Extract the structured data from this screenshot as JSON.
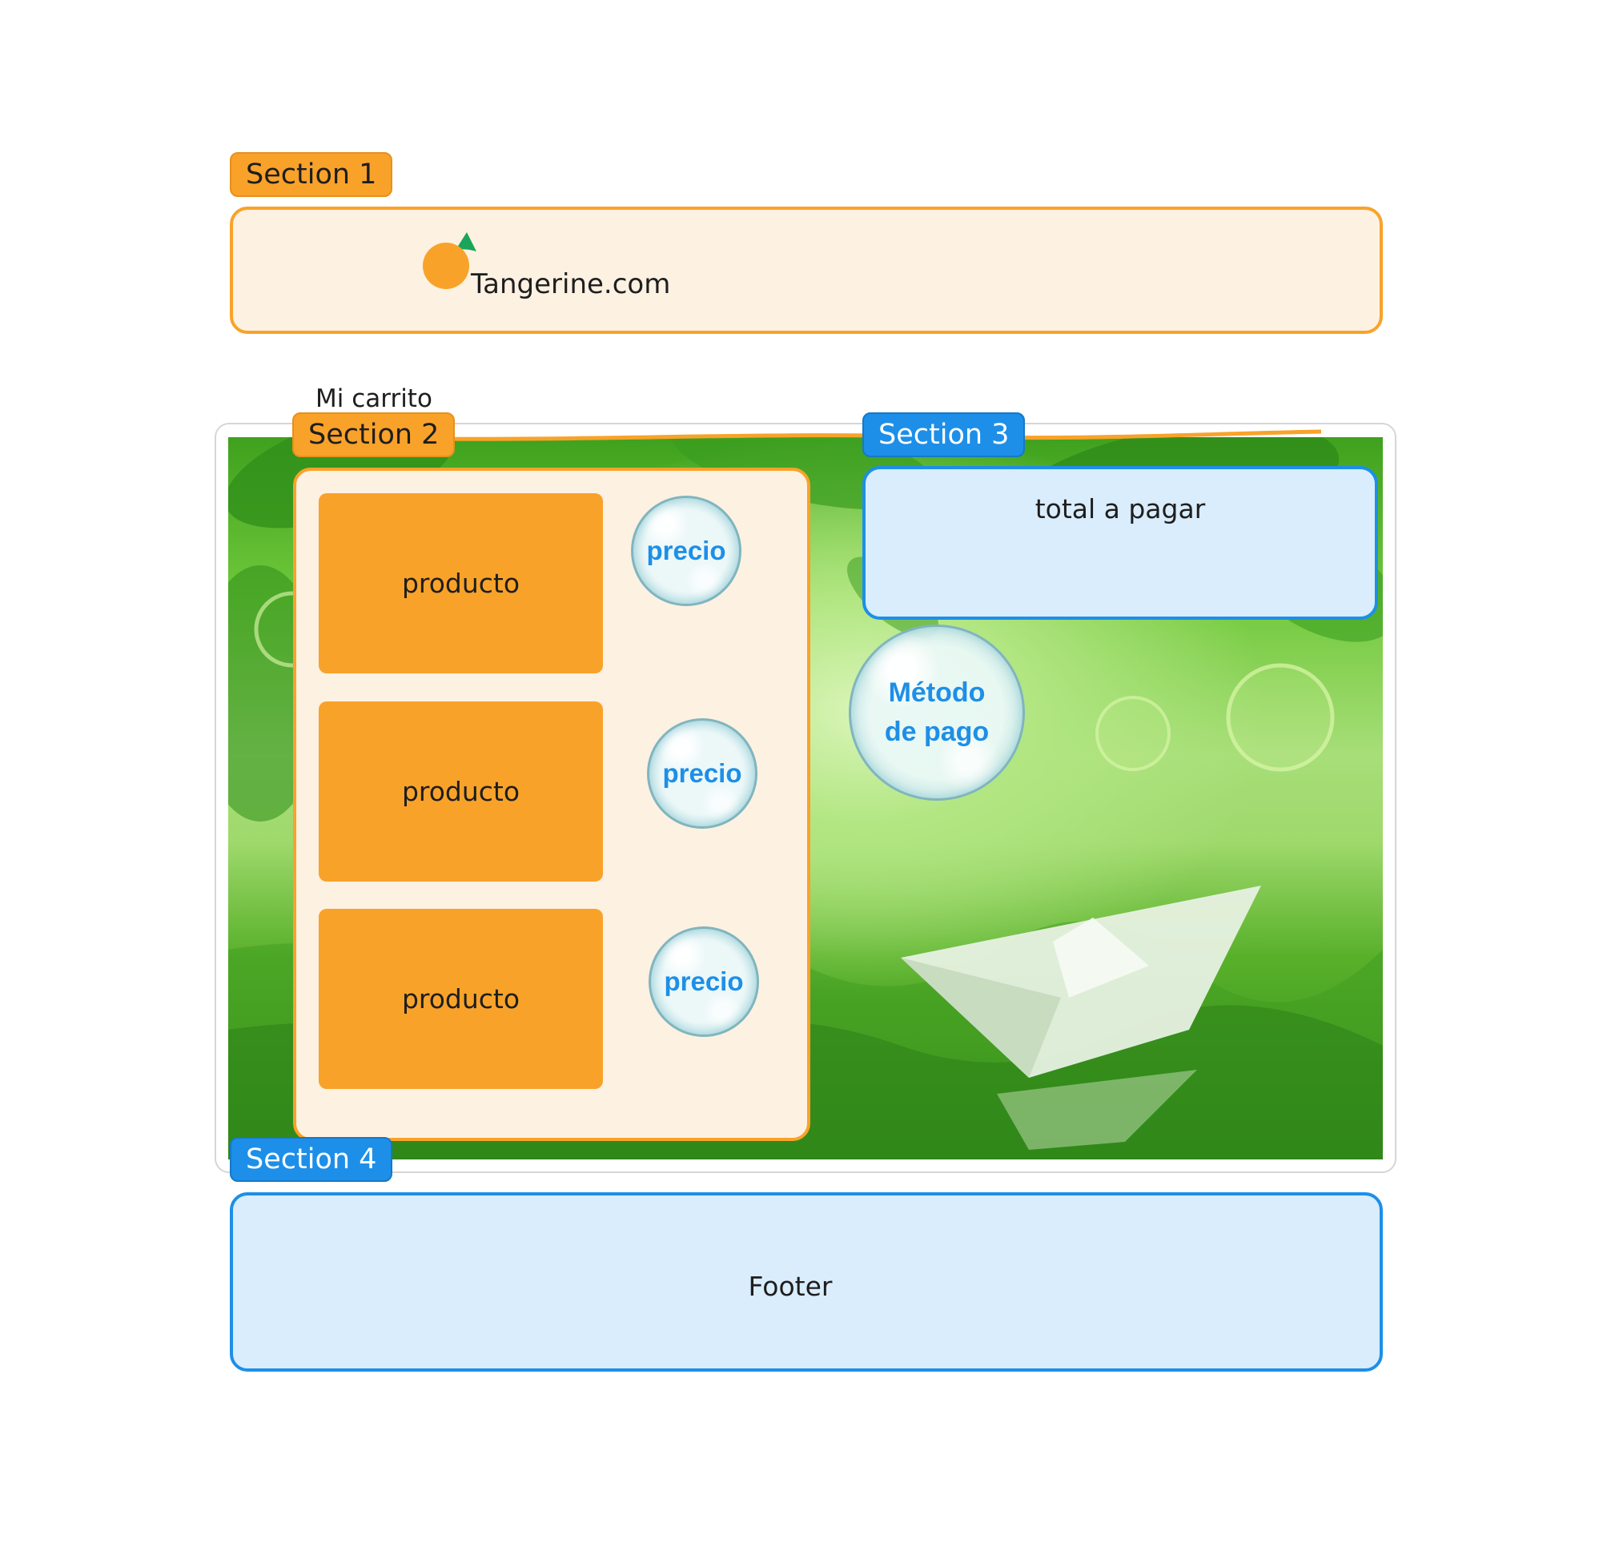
{
  "section1": {
    "tag": "Section 1",
    "logo_text": "Tangerine.com"
  },
  "cart_label": "Mi carrito",
  "section2": {
    "tag": "Section 2",
    "items": [
      {
        "product": "producto",
        "price": "precio"
      },
      {
        "product": "producto",
        "price": "precio"
      },
      {
        "product": "producto",
        "price": "precio"
      }
    ]
  },
  "section3": {
    "tag": "Section 3",
    "total_label": "total a pagar",
    "payment_line1": "Método",
    "payment_line2": "de pago"
  },
  "section4": {
    "tag": "Section 4",
    "footer_label": "Footer"
  },
  "colors": {
    "orange": "#f9a22a",
    "orange_fill": "#fdf1e2",
    "blue": "#1d8fe8",
    "blue_fill": "#d9edfc",
    "leaf_green": "#19a65a"
  }
}
